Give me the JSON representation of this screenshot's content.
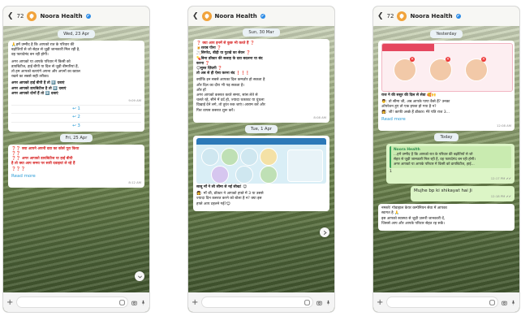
{
  "header": {
    "back_count": "72",
    "contact_name": "Noora Health",
    "verified": "✔"
  },
  "phones": [
    {
      "dates": [
        "Wed, 23 Apr",
        "Fri, 25 Apr"
      ],
      "msg1": {
        "lines": [
          "🙏हमें उम्मीद है कि आपको रात के परिवार की",
          "बढ़ोतियों से जो सेहत से जुड़ी जानकारी मिल रही है,",
          "वह फायदेमंद बन रही होगी।"
        ],
        "para2": [
          "अगर आपको या आपके परिवार में किसी को",
          "डायबिटीज, हाई बीपी या दिल से जुड़ी बीमारियां हैं,",
          "तो हम आपको बताएंगे अपना और अपनों का ख्याल",
          "रखने का सबसे सही तरीका।"
        ],
        "q1": "अगर आपको हाई बीपी है तो 1️⃣ दबाएं",
        "q2": "अगर आपको डायबिटीज है तो 2️⃣ दबाएं",
        "q3": "अगर आपको दोनों हैं तो 3️⃣ दबाएं",
        "time": "9:09 AM",
        "options": [
          "1",
          "2",
          "3"
        ]
      },
      "msg2": {
        "lines": [
          "❓❓ क्या आपने अपनी दवा का कोर्स पूरा किया",
          "❓❓",
          "❓❓ अगर आपको डायबिटीज या हाई बीपी",
          "है तो क्या आप समय पर सारी दवाइयां ले रहे हैं",
          "❓❓❓"
        ],
        "read_more": "Read more",
        "time": "8:12 AM"
      }
    },
    {
      "dates": [
        "Sun, 30 Mar",
        "Tue, 1 Apr"
      ],
      "msg1": {
        "lines": [
          "❓ क्या आप इनमें से कुछ भी करते हैं ❓",
          "🍺शराब पीना ❓",
          "🚬सिगरेट, बीड़ी या गुटखे का सेवन ❓",
          "💊बिना डॉक्टर की सलाह के दवा बदलना या बंद",
          "करना ❓",
          "😔सुस्त ज़िंदगी ❓",
          "तो अब से ही ऐसा करना बंद ❗❗❗",
          "क्योंकि इन सबसे आपका दिल कमज़ोर हो सकता है",
          "और दिल का दौरा भी पड़ सकता है।",
          "और हाँ",
          "अगर आपको कसरत करते समय, सांस लेते से",
          "चलते रहे, सीने में दर्द हो, ज्यादा थकावट या धुंधला",
          "दिखाई देने लगे, तो तुरंत रुक जाएं। आराम करें और",
          "फिर वापस कसरत शुरू करें।"
        ],
        "time": "8:08 AM"
      },
      "msg2": {
        "title": "सासू माँ ने ली सीमा से नई सीख! 😊",
        "lines": [
          "👩: माँ जी, डॉक्टर ने आपको हफ्ते में 3 या उससे",
          "ज्यादा दिन कसरत करने को बोला है न? क्या इस",
          "हफ्ते आप टहलने गईं?😊"
        ]
      }
    },
    {
      "dates": [
        "Yesterday",
        "Today"
      ],
      "msg1": {
        "title": "राज ने की ससुर की दिल से सेवा 🥰🙌",
        "lines": [
          "👨: तो सीमा जी, अब आपके पापा कैसे हैं? उनका",
          "ऑपरेशन हुए तो एक हफ्ता हो गया है न?",
          "👩: जी! काफी अच्छे हैं डॉक्टर। मेरे पति राज 3..."
        ],
        "read_more": "Read more",
        "time": "12:08 AM"
      },
      "msg2": {
        "reply_name": "Noora Health",
        "reply_lines": [
          "...हमें उम्मीद है कि आपको रात के परिवार की बढ़ोतियों से जो",
          "सेहत से जुड़ी जानकारी मिल रही है, वह फायदेमंद बन रही होगी।",
          "अगर आपको या आपके परिवार में किसी को डायबिटीज, हाई..."
        ],
        "answer": "1",
        "time": "12:17 PM ✔✔"
      },
      "msg3": {
        "text": "Mujhe bp ki shikayat hai Ji",
        "time": "12:18 PM ✔✔"
      },
      "msg4": {
        "lines": [
          "नमस्ते! गोवाहाल केयर कम्पेनियन सेवा में आपका",
          "स्वागत है 🙏",
          "इस आपको स्वास्थ्य से जुड़ी ज़रूरी जानकारी दें,",
          "जिससे आप और आपके परिवार सेहत रह सकें।"
        ]
      }
    }
  ],
  "colors": {
    "logo": "#f1a33b",
    "link": "#2a9bd6",
    "outgoing": "#dcf5c6",
    "alert": "#d92b2b"
  },
  "icons": [
    "back-arrow-icon",
    "verified-badge-icon",
    "plus-icon",
    "sticker-icon",
    "camera-icon",
    "mic-icon",
    "scroll-down-icon"
  ]
}
